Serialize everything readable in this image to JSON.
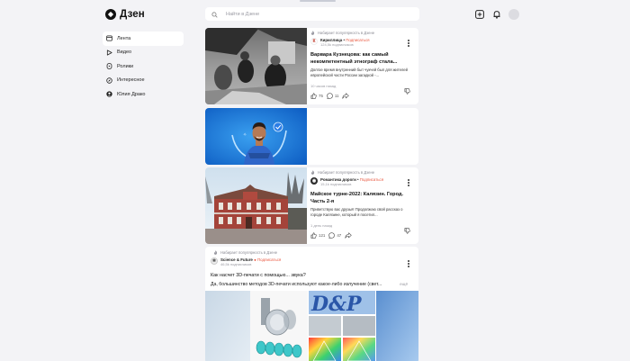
{
  "header": {
    "logo_text": "Дзен",
    "search_placeholder": "Найти в Дзене",
    "icons": [
      "plus-icon",
      "bell-icon",
      "avatar"
    ]
  },
  "sidebar": {
    "items": [
      {
        "label": "Лента",
        "icon": "home-icon",
        "active": true
      },
      {
        "label": "Видео",
        "icon": "play-icon"
      },
      {
        "label": "Ролики",
        "icon": "shorts-icon"
      },
      {
        "label": "Интересное",
        "icon": "compass-icon"
      },
      {
        "label": "Юлия Драко",
        "icon": "profile-icon"
      }
    ]
  },
  "cards": [
    {
      "promo": "Набирает популярность в Дзене",
      "source": "Кириллица",
      "subscribe": "Подписаться",
      "subscribers": "124,5k подписчиков",
      "title": "Варвара Кузнецова: как самый некомпетентный этнограф стала...",
      "description": "Долгое время внутренний быт чукчей был для жителей европейской части России загадкой -...",
      "time": "10 часов назад",
      "likes": "75",
      "comments": "11"
    },
    {
      "type": "video-promo"
    },
    {
      "promo": "Набирает популярность в Дзене",
      "source": "Романтика дороги",
      "subscribe": "Подписаться",
      "subscribers": "15,1k подписчиков",
      "title": "Майское турне-2022: Калязин. Город. Часть 2-я",
      "description": "Приветствую вас друзья! Продолжаю свой рассказ о городе Калязине, который я посетил...",
      "time": "1 день назад",
      "likes": "121",
      "comments": "47"
    },
    {
      "promo": "Набирает популярность в Дзене",
      "source": "Science & Future",
      "subscribe": "Подписаться",
      "subscribers": "46,5k подписчиков",
      "question": "Как насчет 3D-печати с помощью... звука?",
      "text": "Да, большинство методов 3D-печати используют какое-либо излучение (свет...",
      "more": "ещё"
    }
  ]
}
